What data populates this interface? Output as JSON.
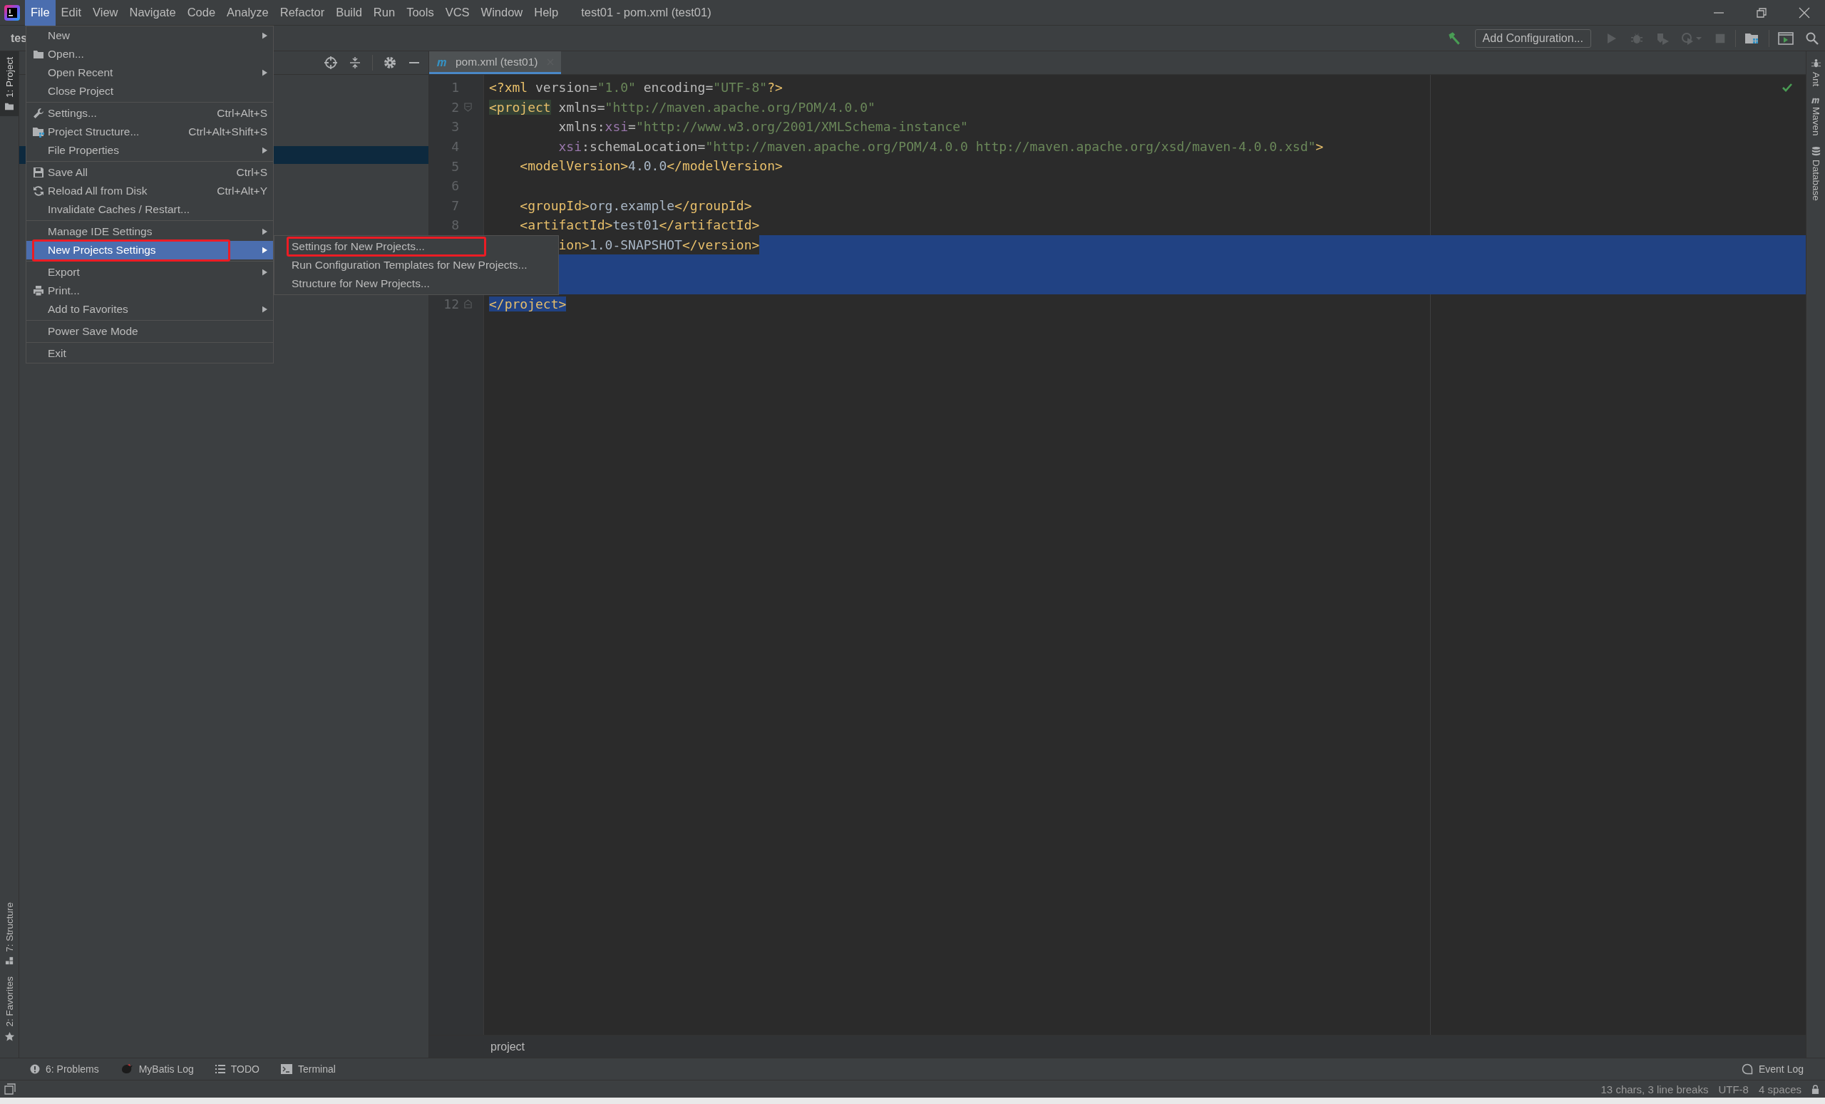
{
  "window": {
    "title": "test01 - pom.xml (test01)"
  },
  "menu_bar": [
    {
      "label": "File",
      "selected": true
    },
    {
      "label": "Edit",
      "selected": false
    },
    {
      "label": "View",
      "selected": false
    },
    {
      "label": "Navigate",
      "selected": false
    },
    {
      "label": "Code",
      "selected": false
    },
    {
      "label": "Analyze",
      "selected": false
    },
    {
      "label": "Refactor",
      "selected": false
    },
    {
      "label": "Build",
      "selected": false
    },
    {
      "label": "Run",
      "selected": false
    },
    {
      "label": "Tools",
      "selected": false
    },
    {
      "label": "VCS",
      "selected": false
    },
    {
      "label": "Window",
      "selected": false
    },
    {
      "label": "Help",
      "selected": false
    }
  ],
  "toolbar": {
    "project_name": "tes",
    "run_config_button": "Add Configuration..."
  },
  "left_tool_tabs_top": [
    {
      "label": "1: Project",
      "selected": true
    }
  ],
  "left_tool_tabs_bottom": [
    {
      "label": "7: Structure",
      "selected": false
    },
    {
      "label": "2: Favorites",
      "selected": false
    }
  ],
  "right_tool_tabs": [
    {
      "label": "Ant"
    },
    {
      "label": "Maven"
    },
    {
      "label": "Database"
    }
  ],
  "file_menu": [
    {
      "kind": "item",
      "label": "New",
      "submenu": true,
      "selected": false,
      "annotated": false
    },
    {
      "kind": "item",
      "label": "Open...",
      "submenu": false,
      "selected": false,
      "annotated": false
    },
    {
      "kind": "item",
      "label": "Open Recent",
      "submenu": true,
      "selected": false,
      "annotated": false
    },
    {
      "kind": "item",
      "label": "Close Project",
      "submenu": false,
      "selected": false,
      "annotated": false
    },
    {
      "kind": "separator"
    },
    {
      "kind": "item",
      "label": "Settings...",
      "shortcut": "Ctrl+Alt+S",
      "submenu": false,
      "selected": false,
      "annotated": false
    },
    {
      "kind": "item",
      "label": "Project Structure...",
      "shortcut": "Ctrl+Alt+Shift+S",
      "submenu": false,
      "selected": false,
      "annotated": false
    },
    {
      "kind": "item",
      "label": "File Properties",
      "submenu": true,
      "selected": false,
      "annotated": false
    },
    {
      "kind": "separator"
    },
    {
      "kind": "item",
      "label": "Save All",
      "shortcut": "Ctrl+S",
      "submenu": false,
      "selected": false,
      "annotated": false
    },
    {
      "kind": "item",
      "label": "Reload All from Disk",
      "shortcut": "Ctrl+Alt+Y",
      "submenu": false,
      "selected": false,
      "annotated": false
    },
    {
      "kind": "item",
      "label": "Invalidate Caches / Restart...",
      "submenu": false,
      "selected": false,
      "annotated": false
    },
    {
      "kind": "separator"
    },
    {
      "kind": "item",
      "label": "Manage IDE Settings",
      "submenu": true,
      "selected": false,
      "annotated": false
    },
    {
      "kind": "item",
      "label": "New Projects Settings",
      "submenu": true,
      "selected": true,
      "annotated": true
    },
    {
      "kind": "separator"
    },
    {
      "kind": "item",
      "label": "Export",
      "submenu": true,
      "selected": false,
      "annotated": false
    },
    {
      "kind": "item",
      "label": "Print...",
      "submenu": false,
      "selected": false,
      "annotated": false
    },
    {
      "kind": "item",
      "label": "Add to Favorites",
      "submenu": true,
      "selected": false,
      "annotated": false
    },
    {
      "kind": "separator"
    },
    {
      "kind": "item",
      "label": "Power Save Mode",
      "submenu": false,
      "selected": false,
      "annotated": false
    },
    {
      "kind": "separator"
    },
    {
      "kind": "item",
      "label": "Exit",
      "submenu": false,
      "selected": false,
      "annotated": false
    }
  ],
  "submenu": [
    {
      "label": "Settings for New Projects...",
      "annotated": true
    },
    {
      "label": "Run Configuration Templates for New Projects...",
      "annotated": false
    },
    {
      "label": "Structure for New Projects...",
      "annotated": false
    }
  ],
  "editor": {
    "tab": {
      "label": "pom.xml (test01)",
      "selected": true
    },
    "lines": [
      {
        "number": "1",
        "fold_start": false,
        "fold_end": false,
        "selected": false,
        "segments": [
          {
            "kind": "tag",
            "t": "<?xml "
          },
          {
            "kind": "attr",
            "t": "version="
          },
          {
            "kind": "str",
            "t": "\"1.0\" "
          },
          {
            "kind": "attr",
            "t": "encoding="
          },
          {
            "kind": "str",
            "t": "\"UTF-8\""
          },
          {
            "kind": "tag",
            "t": "?>"
          }
        ]
      },
      {
        "number": "2",
        "fold_start": true,
        "fold_end": false,
        "selected": false,
        "segments": [
          {
            "kind": "tag",
            "t": "<project",
            "match": true
          },
          {
            "kind": "attr",
            "t": " xmlns="
          },
          {
            "kind": "str",
            "t": "\"http://maven.apache.org/POM/4.0.0\""
          }
        ]
      },
      {
        "number": "3",
        "fold_start": false,
        "fold_end": false,
        "selected": false,
        "segments": [
          {
            "kind": "attr",
            "t": "         xmlns:"
          },
          {
            "kind": "ns",
            "t": "xsi"
          },
          {
            "kind": "attr",
            "t": "="
          },
          {
            "kind": "str",
            "t": "\"http://www.w3.org/2001/XMLSchema-instance\""
          }
        ]
      },
      {
        "number": "4",
        "fold_start": false,
        "fold_end": false,
        "selected": false,
        "segments": [
          {
            "kind": "ns",
            "t": "         xsi"
          },
          {
            "kind": "attr",
            "t": ":schemaLocation="
          },
          {
            "kind": "str",
            "t": "\"http://maven.apache.org/POM/4.0.0 http://maven.apache.org/xsd/maven-4.0.0.xsd\""
          },
          {
            "kind": "tag",
            "t": ">"
          }
        ]
      },
      {
        "number": "5",
        "fold_start": false,
        "fold_end": false,
        "selected": false,
        "segments": [
          {
            "kind": "tag",
            "t": "    <modelVersion>"
          },
          {
            "kind": "txt",
            "t": "4.0.0"
          },
          {
            "kind": "tag",
            "t": "</modelVersion>"
          }
        ]
      },
      {
        "number": "6",
        "fold_start": false,
        "fold_end": false,
        "selected": false
      },
      {
        "number": "7",
        "fold_start": false,
        "fold_end": false,
        "selected": false,
        "segments": [
          {
            "kind": "tag",
            "t": "    <groupId>"
          },
          {
            "kind": "txt",
            "t": "org.example"
          },
          {
            "kind": "tag",
            "t": "</groupId>"
          }
        ]
      },
      {
        "number": "8",
        "fold_start": false,
        "fold_end": false,
        "selected": false,
        "segments": [
          {
            "kind": "tag",
            "t": "    <artifactId>"
          },
          {
            "kind": "txt",
            "t": "test01"
          },
          {
            "kind": "tag",
            "t": "</artifactId>"
          }
        ]
      },
      {
        "fold_start": false,
        "fold_end": false,
        "selected": true,
        "segments": [
          {
            "kind": "tag",
            "t": "         ion>"
          },
          {
            "kind": "txt",
            "t": "1.0-SNAPSHOT"
          },
          {
            "kind": "tag",
            "t": "</version>"
          }
        ]
      },
      {
        "fold_start": false,
        "fold_end": false,
        "selected": true
      },
      {
        "fold_start": false,
        "fold_end": false,
        "selected": true
      },
      {
        "number": "12",
        "fold_start": false,
        "fold_end": true,
        "selected": false,
        "segments": [
          {
            "kind": "tag",
            "t": "</project>",
            "selected": true
          }
        ]
      }
    ],
    "breadcrumb": "project"
  },
  "bottom_tool_tabs": [
    {
      "label": "6: Problems"
    },
    {
      "label": "MyBatis Log"
    },
    {
      "label": "TODO"
    },
    {
      "label": "Terminal"
    }
  ],
  "event_log": "Event Log",
  "status_bar": [
    "13 chars, 3 line breaks",
    "UTF-8",
    "4 spaces"
  ]
}
